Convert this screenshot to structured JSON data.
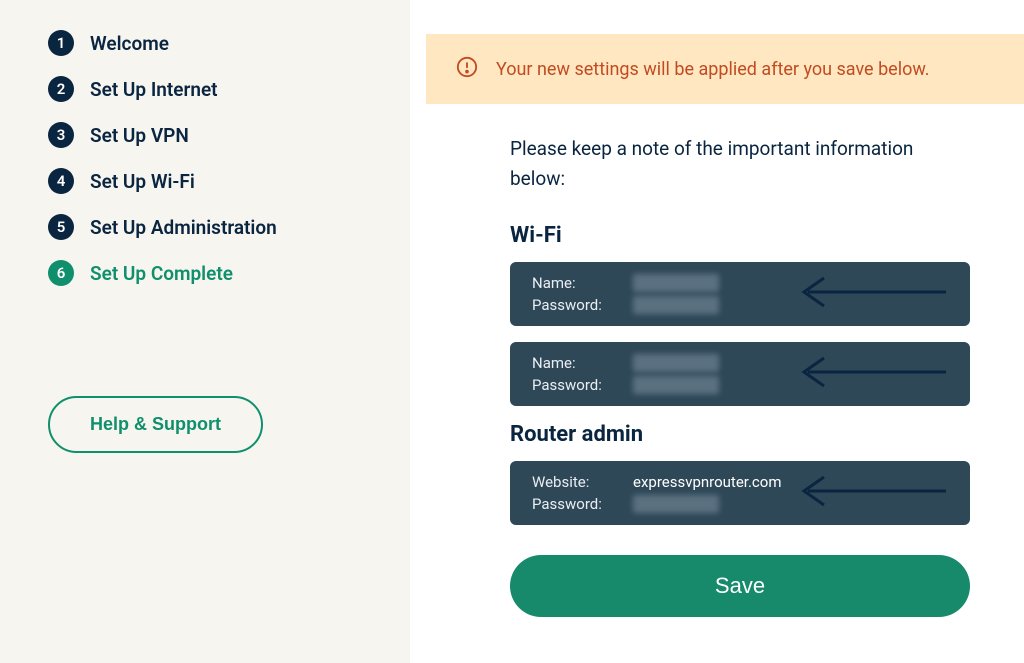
{
  "sidebar": {
    "steps": [
      {
        "num": "1",
        "label": "Welcome"
      },
      {
        "num": "2",
        "label": "Set Up Internet"
      },
      {
        "num": "3",
        "label": "Set Up VPN"
      },
      {
        "num": "4",
        "label": "Set Up Wi-Fi"
      },
      {
        "num": "5",
        "label": "Set Up Administration"
      },
      {
        "num": "6",
        "label": "Set Up Complete"
      }
    ],
    "help_label": "Help & Support"
  },
  "alert": {
    "text": "Your new settings will be applied after you save below."
  },
  "content": {
    "instruction": "Please keep a note of the important information below:",
    "wifi_title": "Wi-Fi",
    "wifi_cards": [
      {
        "name_label": "Name:",
        "password_label": "Password:"
      },
      {
        "name_label": "Name:",
        "password_label": "Password:"
      }
    ],
    "router_title": "Router admin",
    "router_card": {
      "website_label": "Website:",
      "website_value": "expressvpnrouter.com",
      "password_label": "Password:"
    },
    "save_label": "Save"
  }
}
